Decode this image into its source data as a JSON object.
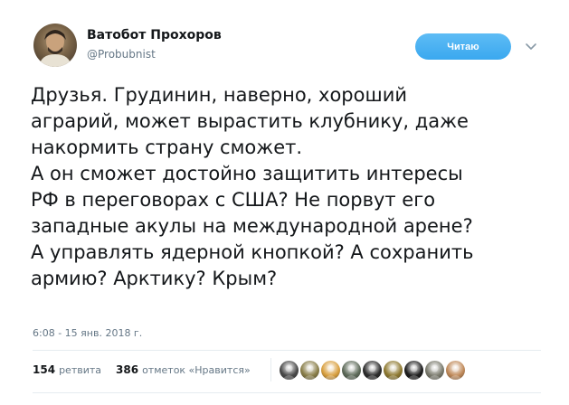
{
  "user": {
    "name": "Ватобот Прохоров",
    "handle": "@Probubnist"
  },
  "follow_button": {
    "label": "Читаю",
    "color": "#1da1f2"
  },
  "tweet": {
    "lines": [
      "Друзья. Грудинин, наверно, хороший",
      "аграрий, может вырастить клубнику, даже",
      "накормить страну сможет.",
      "А он сможет достойно защитить интересы",
      "РФ в переговорах с США? Не порвут его",
      "западные акулы на международной арене?",
      "А управлять ядерной кнопкой? А сохранить",
      "армию? Арктику? Крым?"
    ],
    "timestamp": "6:08 - 15 янв. 2018 г."
  },
  "stats": {
    "retweets_count": "154",
    "retweets_label": "ретвита",
    "likes_count": "386",
    "likes_label": "отметок «Нравится»"
  },
  "likers": [
    {
      "icon": "avatar-icon",
      "color": "#4a4a4a"
    },
    {
      "icon": "avatar-icon",
      "color": "#8a7f4a"
    },
    {
      "icon": "avatar-icon",
      "color": "#d9a040"
    },
    {
      "icon": "avatar-icon",
      "color": "#5e6b5a"
    },
    {
      "icon": "avatar-icon",
      "color": "#2c2c2c"
    },
    {
      "icon": "avatar-icon",
      "color": "#8f7a32"
    },
    {
      "icon": "avatar-icon",
      "color": "#1e1e1e"
    },
    {
      "icon": "avatar-icon",
      "color": "#7b7b6e"
    },
    {
      "icon": "avatar-icon",
      "color": "#c08a5a"
    }
  ]
}
